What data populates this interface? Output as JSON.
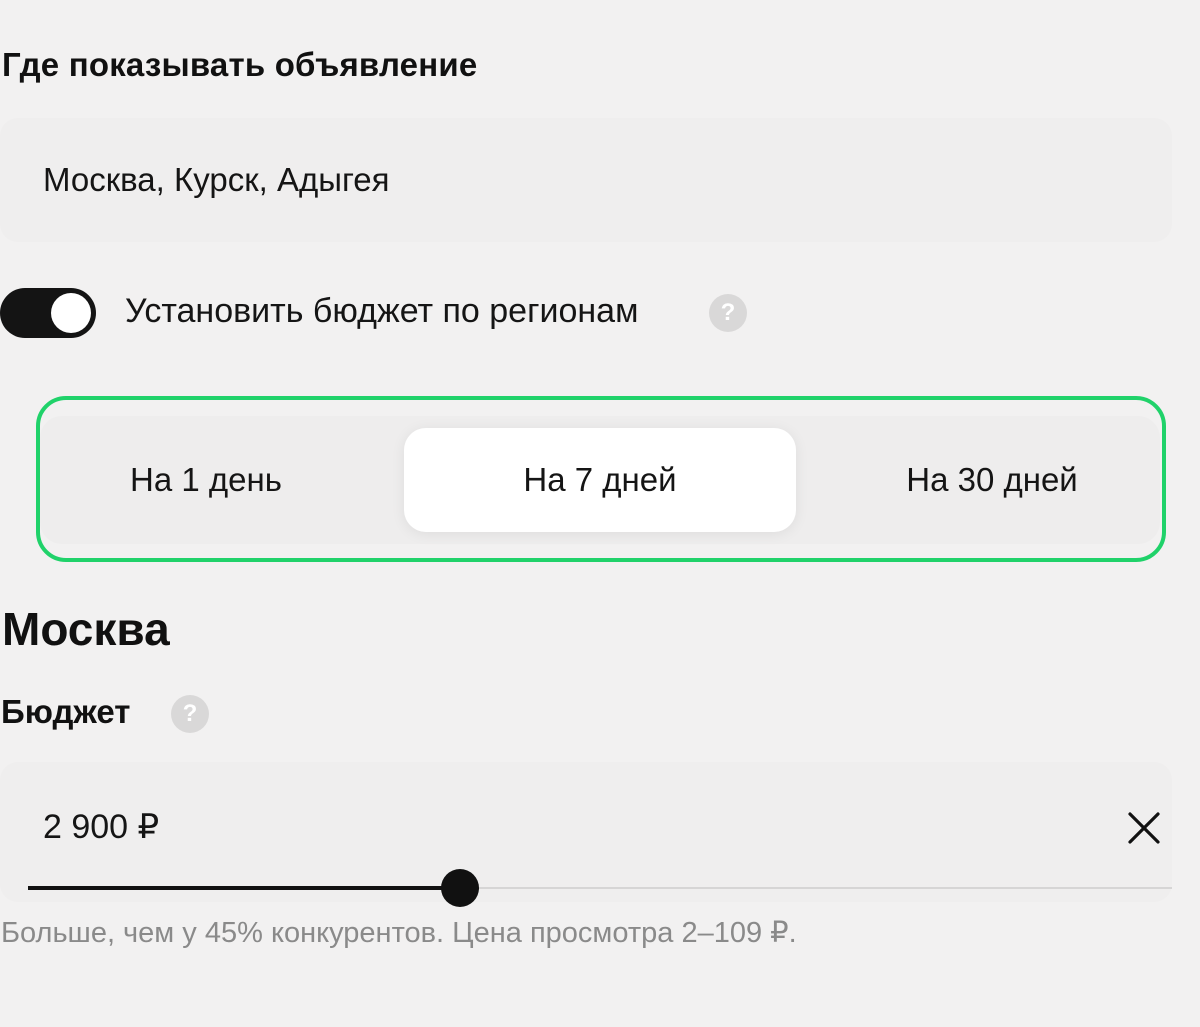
{
  "placement": {
    "title": "Где показывать объявление",
    "regions_value": "Москва, Курск, Адыгея"
  },
  "regional_budget": {
    "toggle_on": true,
    "label": "Установить бюджет по регионам",
    "help_icon": "question-icon"
  },
  "period": {
    "options": [
      "На 1 день",
      "На 7 дней",
      "На 30 дней"
    ],
    "selected_index": 1
  },
  "city": {
    "name": "Москва",
    "budget": {
      "label": "Бюджет",
      "help_icon": "question-icon",
      "value": "2 900  ₽",
      "clear_icon": "close-icon",
      "slider_level": 0.378,
      "hint": "Больше, чем у 45% конкурентов. Цена просмотра 2–109 ₽."
    }
  },
  "colors": {
    "background": "#f2f1f1",
    "highlight": "#20d26a",
    "toggle": "#141414",
    "hint_text": "#8a8a8a"
  }
}
